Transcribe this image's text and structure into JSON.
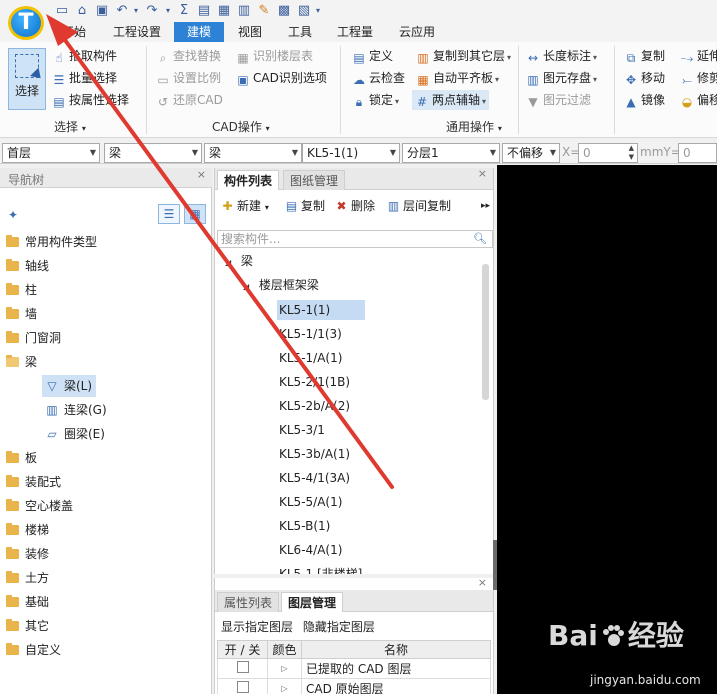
{
  "app": {
    "logo_letter": "T"
  },
  "menu": {
    "tabs": [
      "开始",
      "工程设置",
      "建模",
      "视图",
      "工具",
      "工程量",
      "云应用"
    ],
    "active_index": 2
  },
  "ribbon": {
    "select_group": {
      "big_button": "选择",
      "items": [
        "拾取构件",
        "批量选择",
        "按属性选择"
      ],
      "label": "选择"
    },
    "cad_group": {
      "items": [
        "查找替换",
        "识别楼层表",
        "设置比例",
        "CAD识别选项",
        "还原CAD"
      ],
      "label": "CAD操作"
    },
    "common_group": {
      "items": [
        "定义",
        "复制到其它层",
        "云检查",
        "自动平齐板",
        "锁定",
        "两点辅轴"
      ],
      "label": "通用操作"
    },
    "edit_group": {
      "items": [
        "长度标注",
        "复制",
        "延伸",
        "图元存盘",
        "移动",
        "修剪",
        "图元过滤",
        "镜像",
        "偏移"
      ]
    }
  },
  "combobar": {
    "floor": "首层",
    "category": "梁",
    "type": "梁",
    "component": "KL5-1(1)",
    "layer": "分层1",
    "offset": "不偏移",
    "x_label": "X=",
    "x_value": "0",
    "y_label": "mmY=",
    "y_value": "0"
  },
  "nav": {
    "title": "导航树",
    "close": "×",
    "items": [
      "常用构件类型",
      "轴线",
      "柱",
      "墙",
      "门窗洞",
      "梁",
      "板",
      "装配式",
      "空心楼盖",
      "楼梯",
      "装修",
      "土方",
      "基础",
      "其它",
      "自定义"
    ],
    "beam_children": [
      {
        "label": "梁(L)",
        "icon": "beam-icon"
      },
      {
        "label": "连梁(G)",
        "icon": "coupling-beam-icon"
      },
      {
        "label": "圈梁(E)",
        "icon": "ring-beam-icon"
      }
    ]
  },
  "component_panel": {
    "tabs": [
      "构件列表",
      "图纸管理"
    ],
    "close": "×",
    "toolbar": {
      "new": "新建",
      "copy": "复制",
      "delete": "删除",
      "floor_copy": "层间复制"
    },
    "search_placeholder": "搜索构件...",
    "root": "梁",
    "group": "楼层框架梁",
    "items": [
      "KL5-1(1)",
      "KL5-1/1(3)",
      "KL5-1/A(1)",
      "KL5-2/1(1B)",
      "KL5-2b/A(2)",
      "KL5-3/1",
      "KL5-3b/A(1)",
      "KL5-4/1(3A)",
      "KL5-5/A(1)",
      "KL5-B(1)",
      "KL6-4/A(1)",
      "KL5-1 [非楼梯]"
    ],
    "selected_index": 0
  },
  "layer_panel": {
    "tabs": [
      "属性列表",
      "图层管理"
    ],
    "close": "×",
    "links": [
      "显示指定图层",
      "隐藏指定图层"
    ],
    "columns": [
      "开 / 关",
      "颜色",
      "名称"
    ],
    "rows": [
      {
        "name": "已提取的 CAD 图层"
      },
      {
        "name": "CAD 原始图层"
      }
    ]
  },
  "watermark": {
    "brand_left": "Bai",
    "brand_right": "经验",
    "url": "jingyan.baidu.com"
  },
  "colors": {
    "accent": "#2d82d6",
    "annotation": "#e03a30",
    "canvas": "#000000"
  }
}
